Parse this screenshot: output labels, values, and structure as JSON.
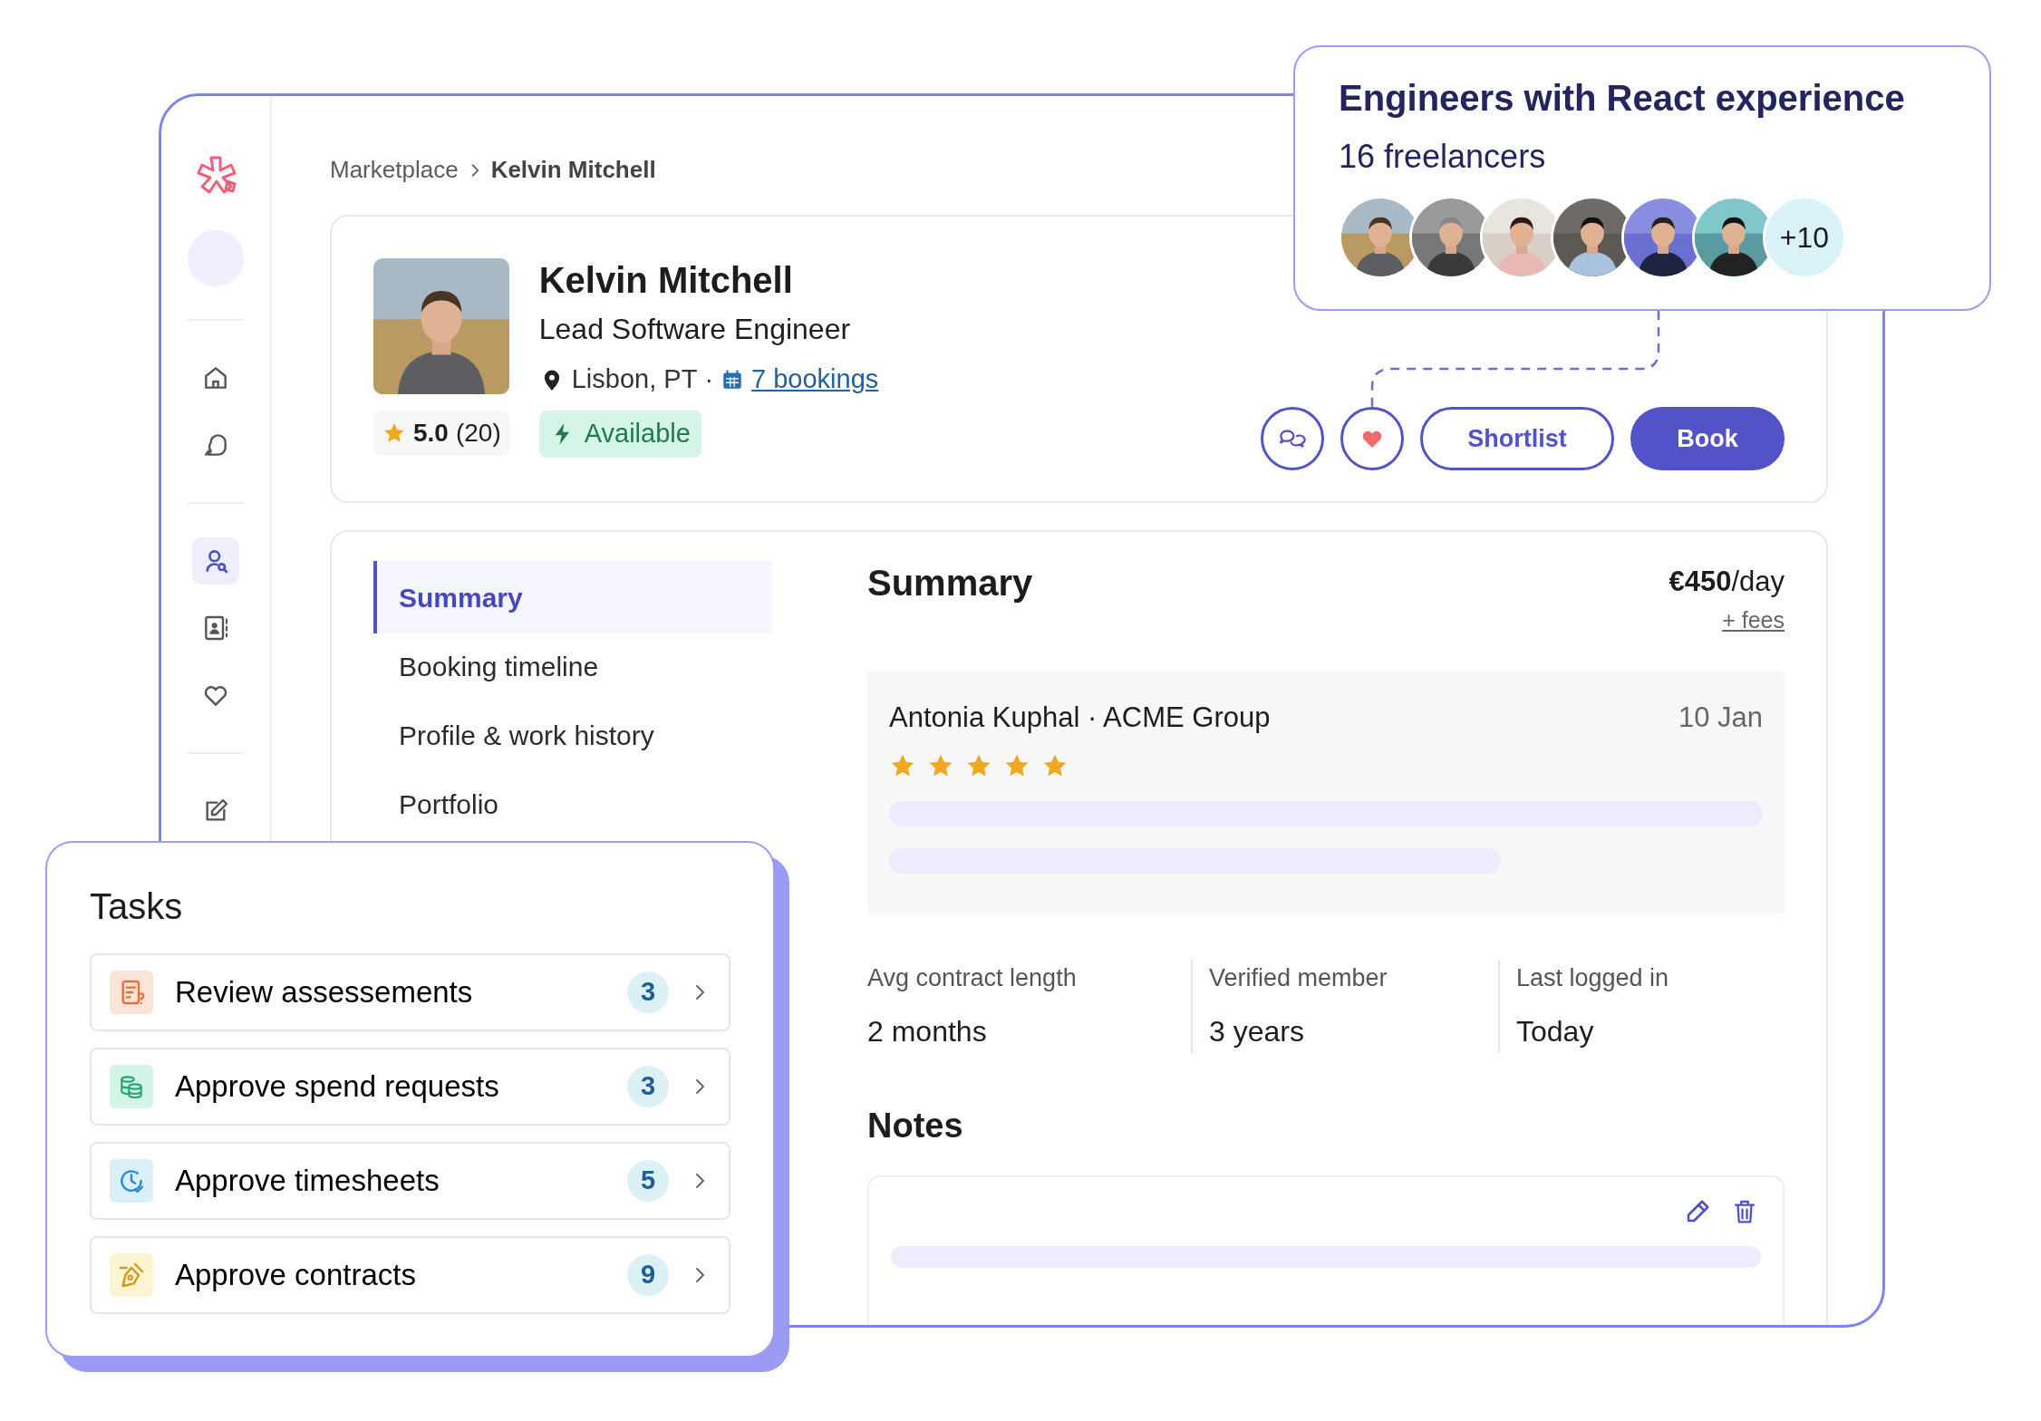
{
  "sidebar": {
    "items": [
      {
        "kind": "home",
        "selected": false
      },
      {
        "kind": "chat",
        "selected": false
      },
      {
        "kind": "people-search",
        "selected": true
      },
      {
        "kind": "contacts",
        "selected": false
      },
      {
        "kind": "heart",
        "selected": false
      },
      {
        "kind": "edit",
        "selected": false
      }
    ]
  },
  "breadcrumb": [
    "Marketplace",
    "Kelvin Mitchell"
  ],
  "profile": {
    "name": "Kelvin Mitchell",
    "title": "Lead Software Engineer",
    "location": "Lisbon, PT",
    "separator": "·",
    "bookings": "7 bookings",
    "rating": "5.0",
    "reviews": "(20)",
    "availability": "Available",
    "favorited": true
  },
  "buttons": [
    "Shortlist",
    "Book"
  ],
  "shortlist_card": {
    "title": "Engineers with React experience",
    "count": "16 freelancers",
    "more": "+10"
  },
  "tabs": [
    {
      "label": "Summary",
      "selected": true
    },
    {
      "label": "Booking timeline",
      "selected": false
    },
    {
      "label": "Profile & work history",
      "selected": false
    },
    {
      "label": "Portfolio",
      "selected": false
    }
  ],
  "summary": {
    "heading": "Summary",
    "rate": "**€450**/day",
    "fees": "+ fees"
  },
  "review": {
    "author": "Antonia Kuphal · ACME Group",
    "date": "10 Jan",
    "stars": 5
  },
  "stats": [
    {
      "label": "Avg contract length",
      "value": "2 months"
    },
    {
      "label": "Verified member",
      "value": "3 years"
    },
    {
      "label": "Last logged in",
      "value": "Today"
    }
  ],
  "notes": {
    "heading": "Notes"
  },
  "tasks": {
    "title": "Tasks",
    "items": [
      {
        "kind": "assessment",
        "label": "Review assessements",
        "count": "3"
      },
      {
        "kind": "spend",
        "label": "Approve spend requests",
        "count": "3"
      },
      {
        "kind": "timesheet",
        "label": "Approve timesheets",
        "count": "5"
      },
      {
        "kind": "contract",
        "label": "Approve contracts",
        "count": "9"
      }
    ]
  }
}
